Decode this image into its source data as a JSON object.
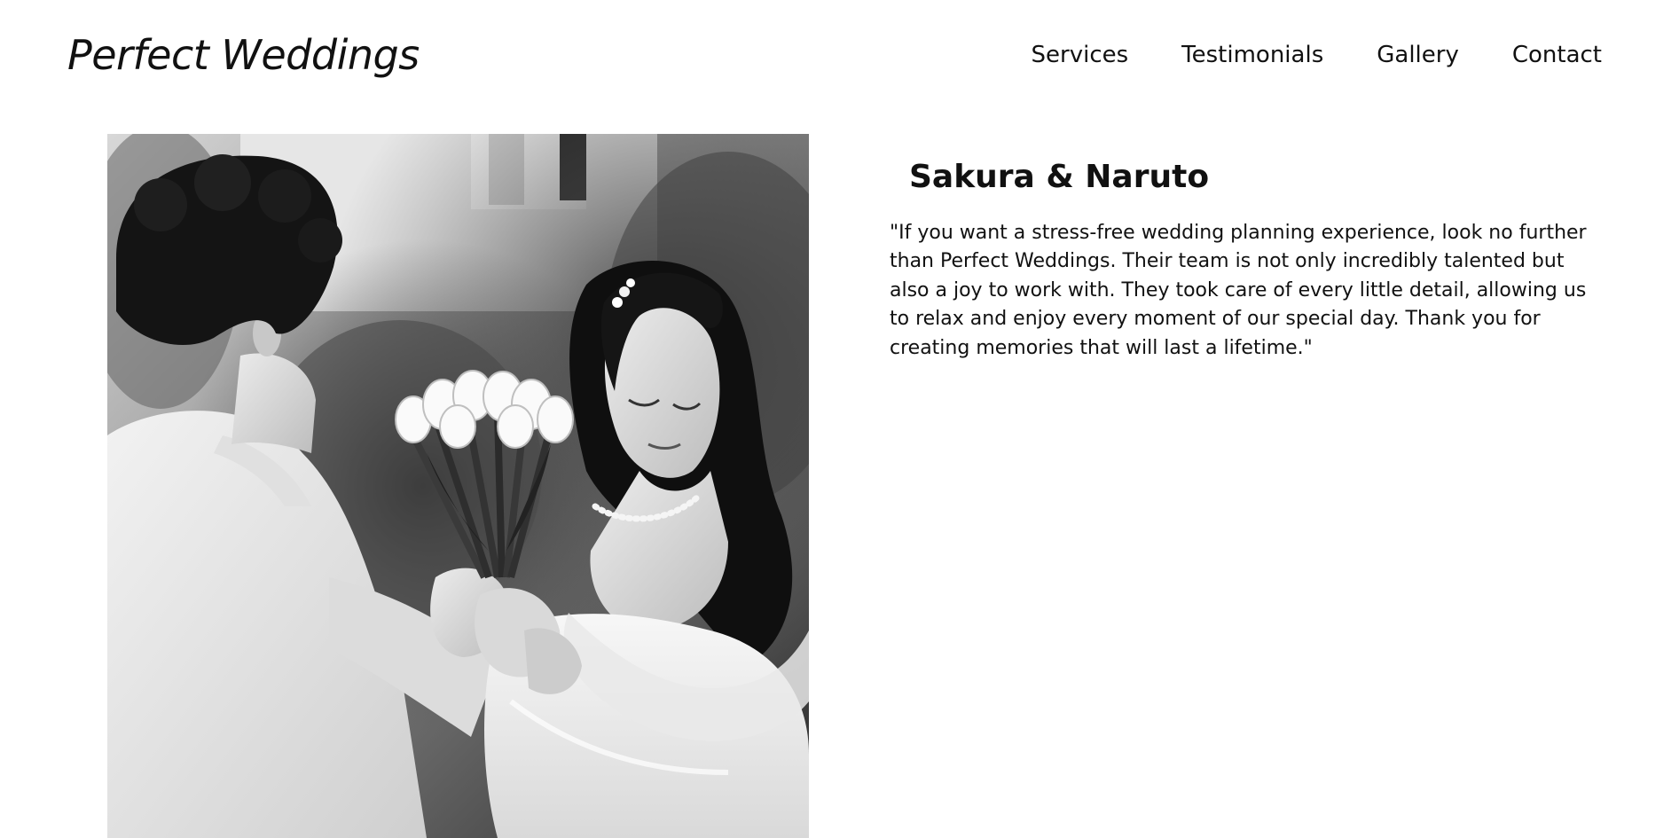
{
  "header": {
    "logo": "Perfect Weddings",
    "nav": [
      {
        "label": "Services"
      },
      {
        "label": "Testimonials"
      },
      {
        "label": "Gallery"
      },
      {
        "label": "Contact"
      }
    ]
  },
  "testimonial": {
    "name": "Sakura & Naruto",
    "quote": "\"If you want a stress-free wedding planning experience, look no further than Perfect Weddings. Their team is not only incredibly talented but also a joy to work with. They took care of every little detail, allowing us to relax and enjoy every moment of our special day. Thank you for creating memories that will last a lifetime.\"",
    "photo": {
      "description_icon": "wedding-couple-photo",
      "style": "black-and-white"
    }
  },
  "colors": {
    "background": "#ffffff",
    "text": "#111111"
  }
}
